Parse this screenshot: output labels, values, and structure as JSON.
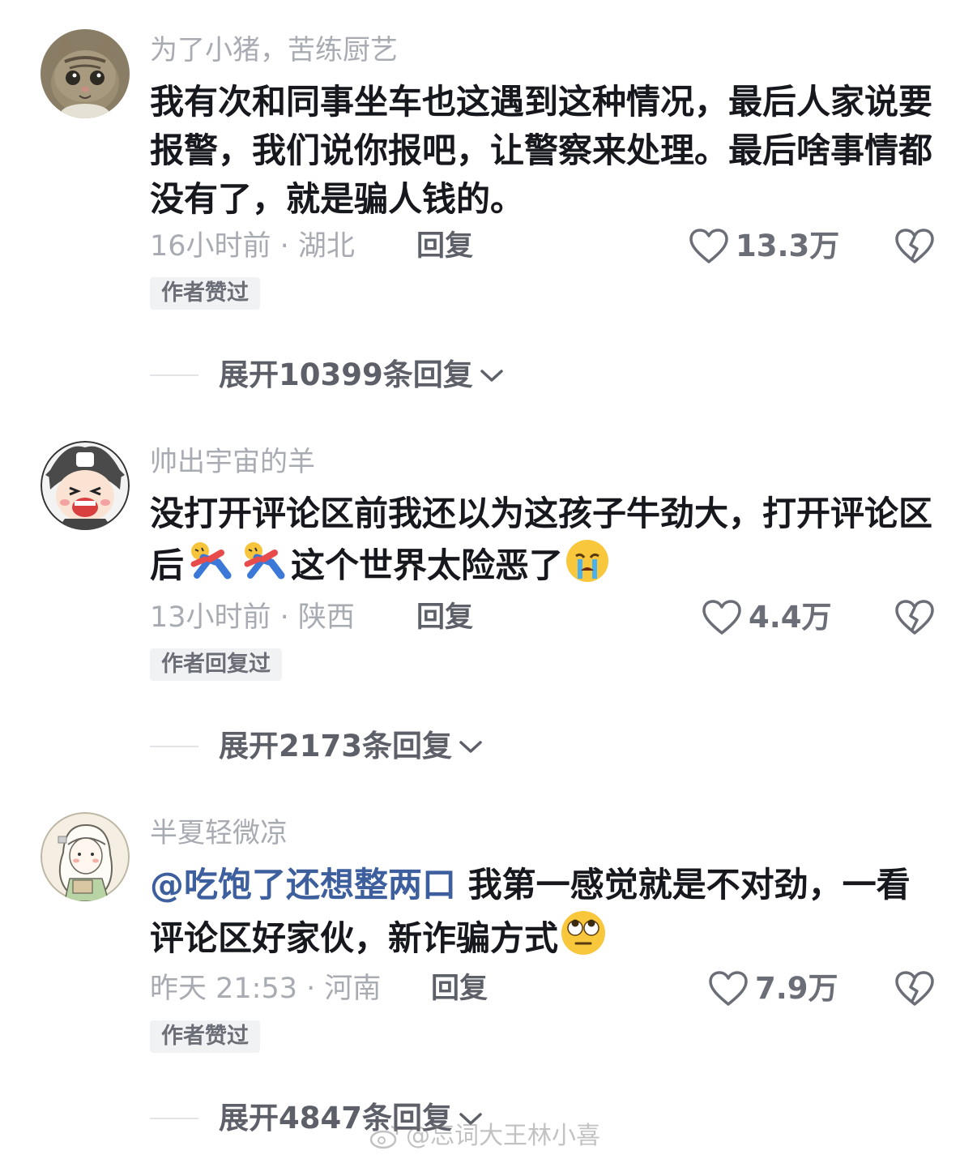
{
  "comments": [
    {
      "username": "为了小猪，苦练厨艺",
      "text": "我有次和同事坐车也这遇到这种情况，最后人家说要报警，我们说你报吧，让警察来处理。最后啥事情都没有了，就是骗人钱的。",
      "time_location": "16小时前 · 湖北",
      "reply_label": "回复",
      "likes": "13.3万",
      "tag": "作者赞过",
      "expand_label": "展开10399条回复"
    },
    {
      "username": "帅出宇宙的羊",
      "text_before": "没打开评论区前我还以为这孩子牛劲大，打开评论区后",
      "text_after": "这个世界太险恶了",
      "emojis": [
        "fall-emoji",
        "fall-emoji",
        "crying-emoji"
      ],
      "time_location": "13小时前 · 陕西",
      "reply_label": "回复",
      "likes": "4.4万",
      "tag": "作者回复过",
      "expand_label": "展开2173条回复"
    },
    {
      "username": "半夏轻微凉",
      "mention": "@吃饱了还想整两口",
      "text": " 我第一感觉就是不对劲，一看评论区好家伙，新诈骗方式",
      "emojis": [
        "rolling-eyes-emoji"
      ],
      "time_location": "昨天 21:53 · 河南",
      "reply_label": "回复",
      "likes": "7.9万",
      "tag": "作者赞过",
      "expand_label": "展开4847条回复"
    }
  ],
  "watermark": "@忘词大王林小喜",
  "colors": {
    "mention": "#3d5f9e",
    "username": "#a9abb3",
    "body": "#16181d",
    "tag_bg": "#f1f2f4"
  }
}
